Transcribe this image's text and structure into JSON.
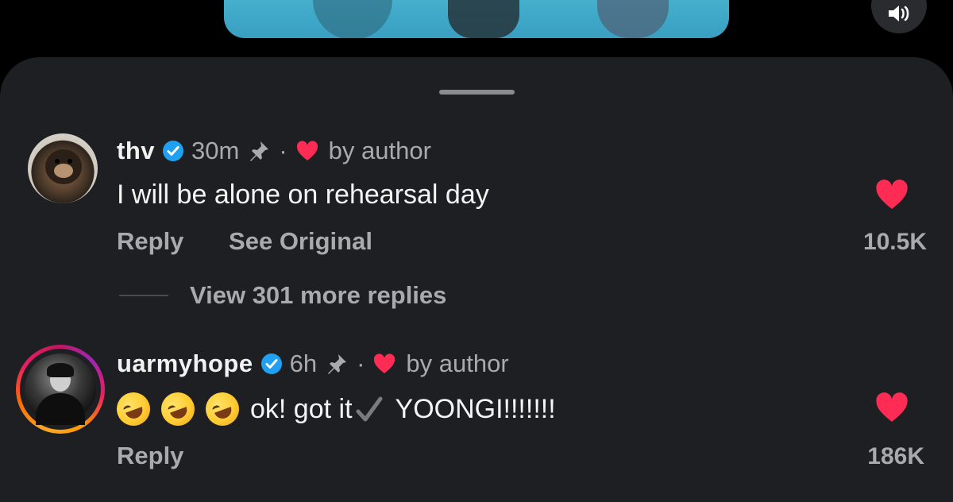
{
  "comments": [
    {
      "username": "thv",
      "time": "30m",
      "separator": "·",
      "badge": "by author",
      "text": "I will be alone on rehearsal day",
      "actions": [
        "Reply",
        "See Original"
      ],
      "likes": "10.5K"
    },
    {
      "username": "uarmyhope",
      "time": "6h",
      "separator": "·",
      "badge": "by author",
      "text_emoji_prefix": "🤣🤣🤣",
      "text_a": "ok! got it",
      "text_b": "YOONGI!!!!!!!",
      "actions": [
        "Reply"
      ],
      "likes": "186K"
    }
  ],
  "view_replies": "View 301 more replies",
  "colors": {
    "accent_red": "#fe2c55",
    "verified_blue": "#20a0f0",
    "sheet_bg": "#1e1f23"
  }
}
